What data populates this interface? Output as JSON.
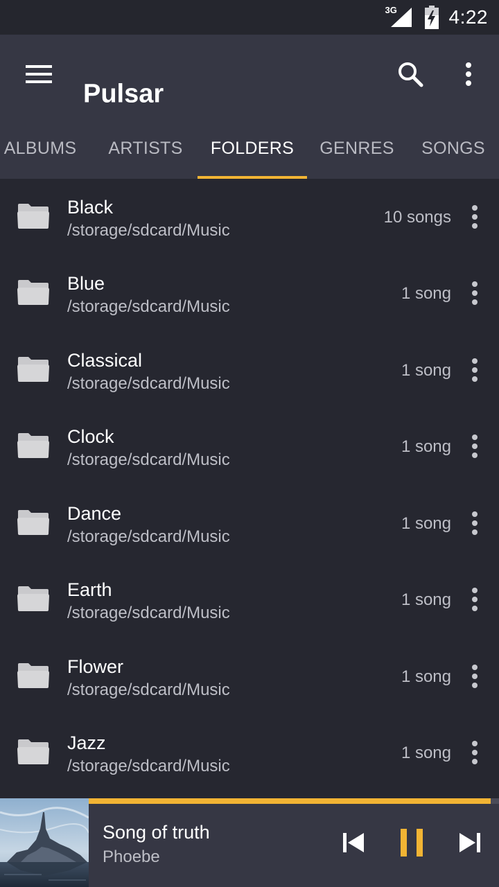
{
  "status_bar": {
    "network": "3G",
    "time": "4:22"
  },
  "app": {
    "title": "Pulsar"
  },
  "tabs": [
    {
      "label": "ALBUMS",
      "active": false
    },
    {
      "label": "ARTISTS",
      "active": false
    },
    {
      "label": "FOLDERS",
      "active": true
    },
    {
      "label": "GENRES",
      "active": false
    },
    {
      "label": "SONGS",
      "active": false
    }
  ],
  "folders": [
    {
      "name": "Black",
      "path": "/storage/sdcard/Music",
      "count": "10 songs"
    },
    {
      "name": "Blue",
      "path": "/storage/sdcard/Music",
      "count": "1 song"
    },
    {
      "name": "Classical",
      "path": "/storage/sdcard/Music",
      "count": "1 song"
    },
    {
      "name": "Clock",
      "path": "/storage/sdcard/Music",
      "count": "1 song"
    },
    {
      "name": "Dance",
      "path": "/storage/sdcard/Music",
      "count": "1 song"
    },
    {
      "name": "Earth",
      "path": "/storage/sdcard/Music",
      "count": "1 song"
    },
    {
      "name": "Flower",
      "path": "/storage/sdcard/Music",
      "count": "1 song"
    },
    {
      "name": "Jazz",
      "path": "/storage/sdcard/Music",
      "count": "1 song"
    }
  ],
  "now_playing": {
    "title": "Song of truth",
    "artist": "Phoebe",
    "progress": 0.98,
    "state": "playing"
  },
  "colors": {
    "accent": "#f2b434",
    "background": "#262730",
    "appbar": "#363744",
    "statusbar": "#25262e",
    "secondary_text": "#bdbec6"
  }
}
